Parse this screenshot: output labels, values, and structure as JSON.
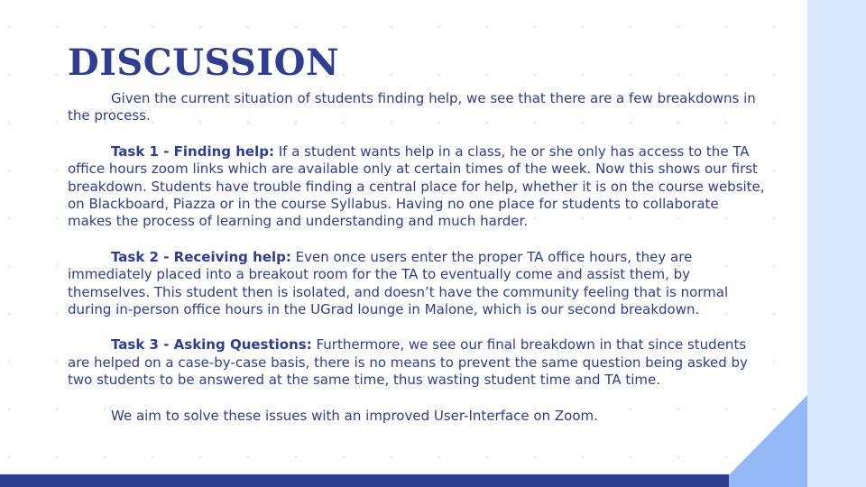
{
  "slide": {
    "title": "DISCUSSION",
    "intro": "Given the current situation of students finding help, we see that there are a few breakdowns in the process.",
    "tasks": [
      {
        "label": "Task 1 - Finding help:",
        "text": " If a student wants help in a class, he or she only has access to the TA office hours zoom links which are available only at certain times of the week.  Now this shows our first breakdown. Students have trouble finding a central place for help, whether it is on the course website, on Blackboard, Piazza or in the course Syllabus. Having no one place for students to collaborate makes the process of learning and understanding and much harder."
      },
      {
        "label": "Task 2 - Receiving help:",
        "text": " Even once users enter the proper TA office hours, they are immediately placed into a breakout room for the TA to eventually come and assist them, by themselves. This student then is isolated, and doesn’t have the community feeling that is normal during in-person office hours in the UGrad lounge in Malone, which is our second breakdown."
      },
      {
        "label": "Task 3 -  Asking Questions:",
        "text": " Furthermore, we see our final breakdown in that since students are helped on a case-by-case basis, there is no means to prevent the same question being asked by two students to be answered at the same time, thus wasting student time and TA time."
      }
    ],
    "conclusion": "We aim to solve these issues with an improved User-Interface on Zoom."
  },
  "colors": {
    "title": "#2e3f91",
    "text": "#2d3f8f",
    "bottom_bar": "#2d3f8f",
    "right_panel": "#dbeafe",
    "corner_triangle": "#93b8f5",
    "dots": "#e6ebf5"
  }
}
